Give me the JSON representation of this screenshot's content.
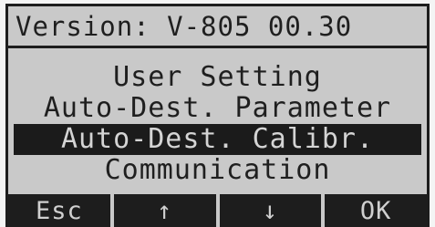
{
  "header": {
    "version_text": "Version: V-805 00.30"
  },
  "menu": {
    "items": [
      {
        "label": "User Setting"
      },
      {
        "label": "Auto-Dest. Parameter"
      },
      {
        "label": "Auto-Dest. Calibr.",
        "selected": true
      },
      {
        "label": "Communication"
      }
    ]
  },
  "softkeys": {
    "esc_label": "Esc",
    "up_label": "↑",
    "down_label": "↓",
    "ok_label": "OK"
  },
  "colors": {
    "lcd_background": "#c9c9c9",
    "lcd_text": "#1f1f1f",
    "selection_background": "#1b1b1b",
    "selection_text": "#d4d4d4"
  }
}
